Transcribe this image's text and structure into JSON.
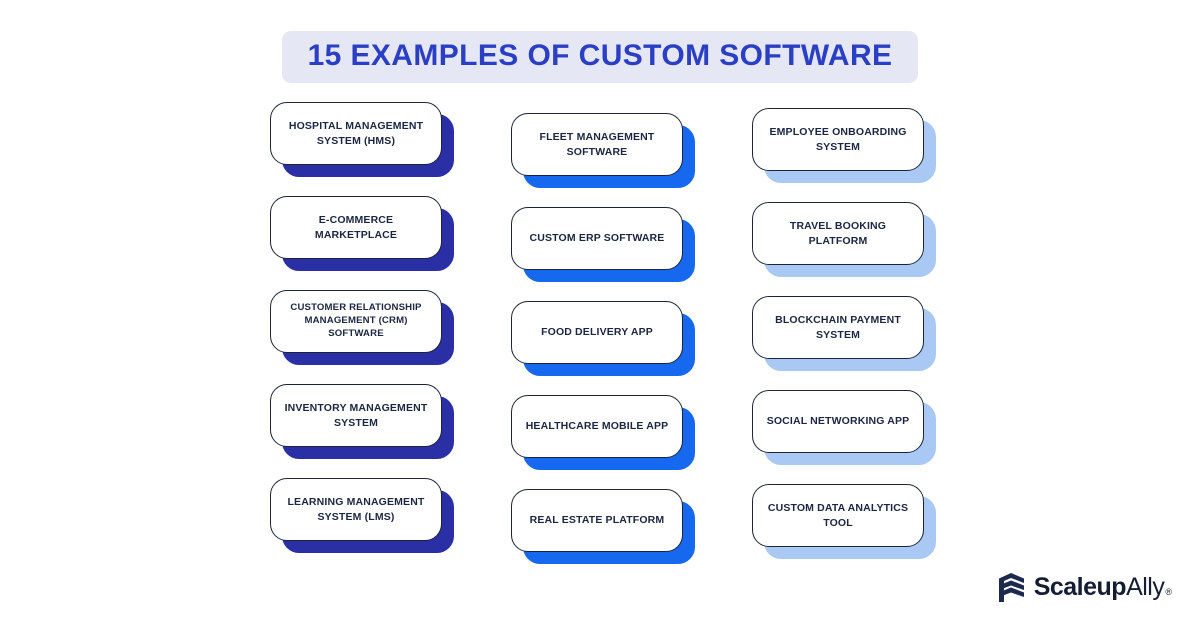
{
  "header": {
    "title": "15 EXAMPLES OF CUSTOM SOFTWARE",
    "band_color": "#e5e8f4",
    "text_color": "#2b3fc4"
  },
  "theme": {
    "background": "#ffffff",
    "card_background": "#ffffff",
    "card_border": "#1c2436",
    "card_text": "#1b2640",
    "shadow_column_1": "#2a2fa6",
    "shadow_column_2": "#1669ee",
    "shadow_column_3": "#a9c9f4"
  },
  "columns": [
    {
      "shadow_color": "#2a2fa6",
      "cards": [
        {
          "label": "HOSPITAL MANAGEMENT SYSTEM (HMS)",
          "small": false
        },
        {
          "label": "E-COMMERCE MARKETPLACE",
          "small": false
        },
        {
          "label": "CUSTOMER RELATIONSHIP MANAGEMENT (CRM) SOFTWARE",
          "small": true
        },
        {
          "label": "INVENTORY MANAGEMENT SYSTEM",
          "small": false
        },
        {
          "label": "LEARNING MANAGEMENT SYSTEM (LMS)",
          "small": false
        }
      ]
    },
    {
      "shadow_color": "#1669ee",
      "cards": [
        {
          "label": "FLEET MANAGEMENT SOFTWARE",
          "small": false
        },
        {
          "label": "CUSTOM ERP SOFTWARE",
          "small": false
        },
        {
          "label": "FOOD DELIVERY APP",
          "small": false
        },
        {
          "label": "HEALTHCARE MOBILE APP",
          "small": false
        },
        {
          "label": "REAL ESTATE PLATFORM",
          "small": false
        }
      ]
    },
    {
      "shadow_color": "#a9c9f4",
      "cards": [
        {
          "label": "EMPLOYEE ONBOARDING SYSTEM",
          "small": false
        },
        {
          "label": "TRAVEL BOOKING PLATFORM",
          "small": false
        },
        {
          "label": "BLOCKCHAIN PAYMENT SYSTEM",
          "small": false
        },
        {
          "label": "SOCIAL NETWORKING APP",
          "small": false
        },
        {
          "label": "CUSTOM DATA ANALYTICS TOOL",
          "small": false
        }
      ]
    }
  ],
  "logo": {
    "name_bold": "Scaleup",
    "name_light": "Ally",
    "registered_mark": "®",
    "mark_color": "#1b2a4e"
  }
}
